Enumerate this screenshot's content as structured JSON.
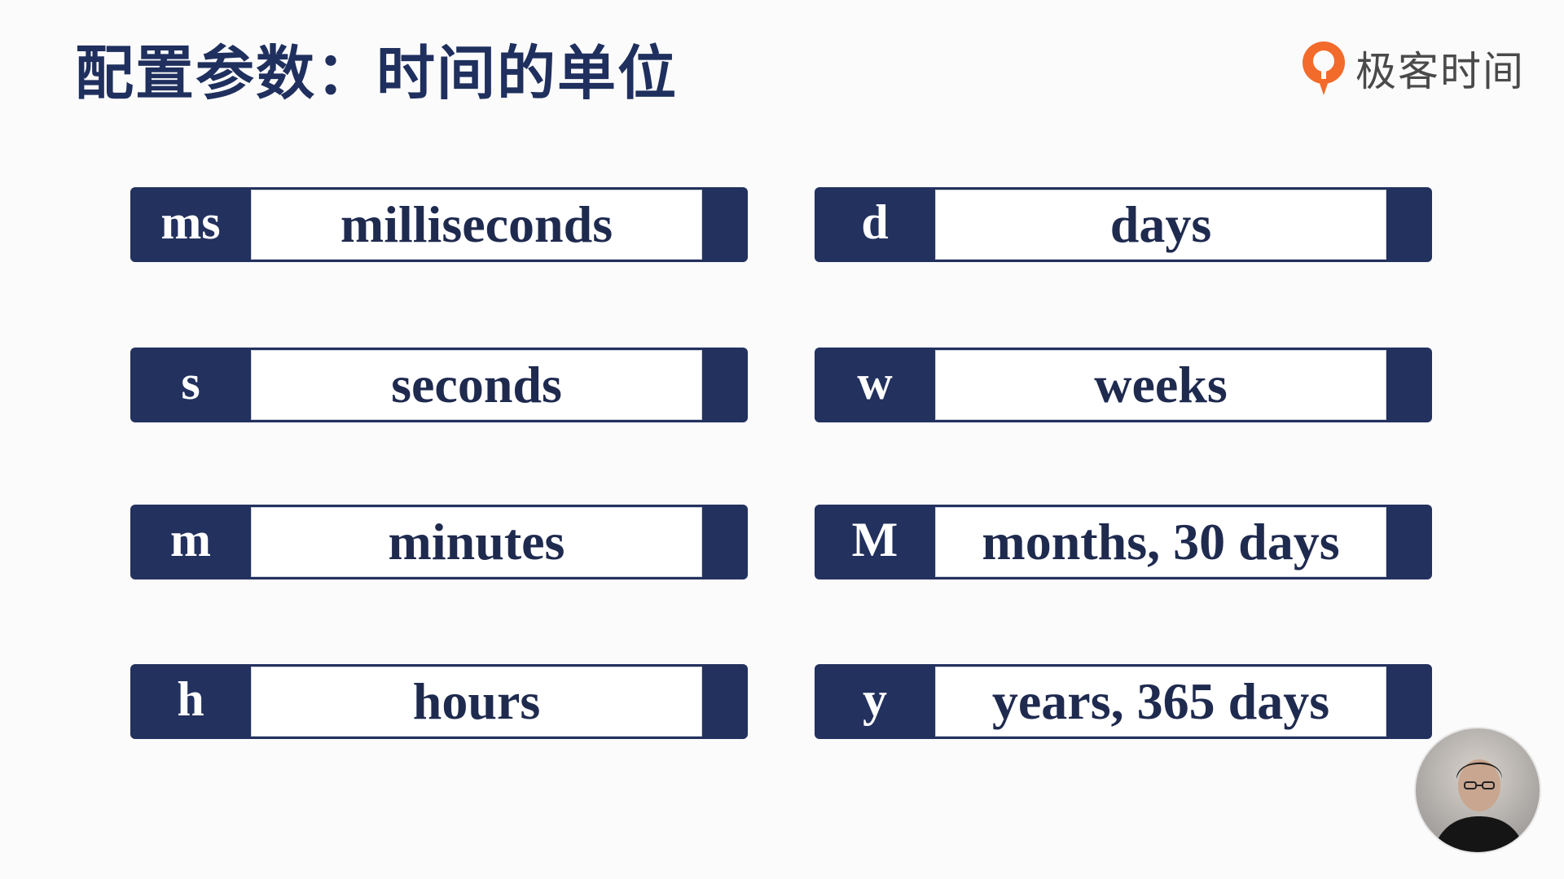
{
  "slide": {
    "title": "配置参数：时间的单位"
  },
  "logo": {
    "text": "极客时间",
    "icon": "geektime-logo-icon",
    "accent_color": "#f26b2b"
  },
  "units_left": [
    {
      "abbr": "ms",
      "name": "milliseconds"
    },
    {
      "abbr": "s",
      "name": "seconds"
    },
    {
      "abbr": "m",
      "name": "minutes"
    },
    {
      "abbr": "h",
      "name": "hours"
    }
  ],
  "units_right": [
    {
      "abbr": "d",
      "name": "days"
    },
    {
      "abbr": "w",
      "name": "weeks"
    },
    {
      "abbr": "M",
      "name": "months, 30 days"
    },
    {
      "abbr": "y",
      "name": "years, 365 days"
    }
  ],
  "colors": {
    "primary_navy": "#23315e",
    "title_color": "#1f2f5e",
    "background": "#fbfbfb"
  },
  "presenter": {
    "icon": "presenter-avatar-icon"
  }
}
